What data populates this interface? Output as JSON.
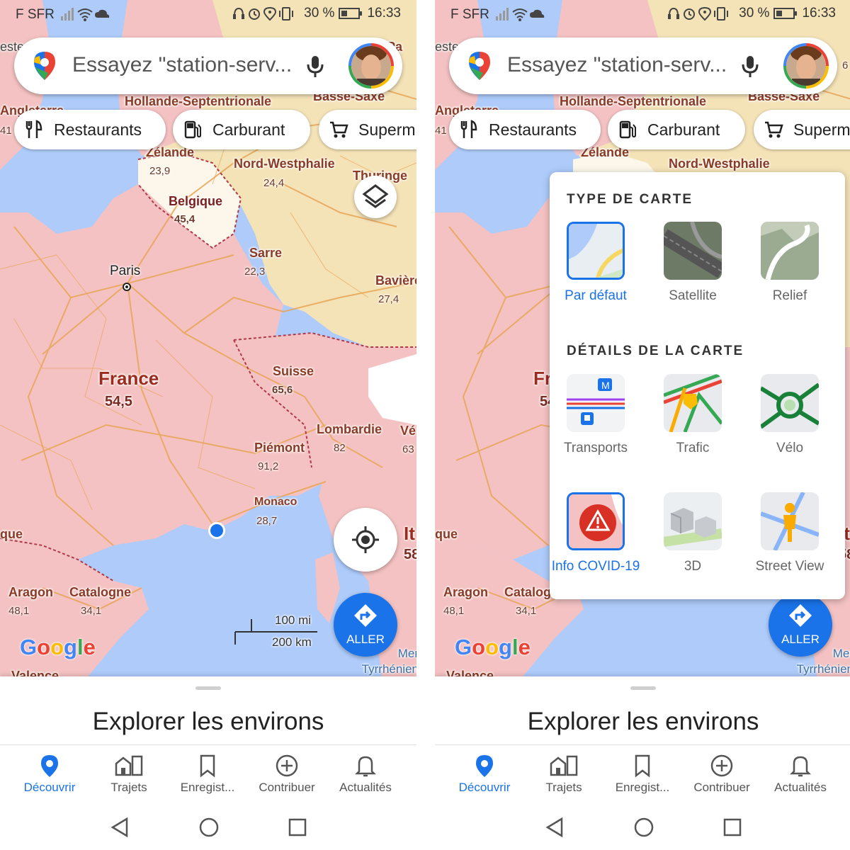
{
  "status_bar": {
    "carrier": "F SFR",
    "battery_percent": "30 %",
    "time": "16:33"
  },
  "search": {
    "placeholder": "Essayez \"station-serv..."
  },
  "chips": [
    {
      "label": "Restaurants",
      "icon": "restaurant-icon"
    },
    {
      "label": "Carburant",
      "icon": "fuel-icon"
    },
    {
      "label": "Superm",
      "icon": "cart-icon"
    }
  ],
  "map": {
    "labels": {
      "hollande": "Hollande-Septentrionale",
      "basse_saxe": "Basse-Saxe",
      "angleterre": "Angleterre",
      "zelande": "Zélande",
      "zelande_num": "23,9",
      "nord_westphalie": "Nord-Westphalie",
      "nrw_num": "24,4",
      "thuringe": "Thuringe",
      "belgique": "Belgique",
      "belgique_num": "45,4",
      "sarre": "Sarre",
      "sarre_num": "22,3",
      "paris": "Paris",
      "baviere": "Bavière",
      "baviere_num": "27,4",
      "france": "France",
      "france_num": "54,5",
      "suisse": "Suisse",
      "suisse_num": "65,6",
      "lombardie": "Lombardie",
      "lombardie_num": "82",
      "piemont": "Piémont",
      "piemont_num": "91,2",
      "venetie": "Vé",
      "venetie_num": "63",
      "monaco": "Monaco",
      "monaco_num": "28,7",
      "italie": "It",
      "italie_num": "58",
      "que": "que",
      "aragon": "Aragon",
      "aragon_num": "48,1",
      "catalogne": "Catalogne",
      "catalogne_num": "34,1",
      "valence": "Valence",
      "sea": "Mer Tyrrhénien",
      "num_41": "41",
      "pays_bas_top": "-Pa",
      "num_6": "6",
      "ouest": "este"
    },
    "google_logo": "Google",
    "scale_mi": "100 mi",
    "scale_km": "200 km",
    "go_label": "ALLER"
  },
  "sheet": {
    "title": "Explorer les environs"
  },
  "bottom_nav": [
    {
      "label": "Découvrir",
      "icon": "pin-icon",
      "active": true
    },
    {
      "label": "Trajets",
      "icon": "commute-icon",
      "active": false
    },
    {
      "label": "Enregist...",
      "icon": "bookmark-icon",
      "active": false
    },
    {
      "label": "Contribuer",
      "icon": "add-circle-icon",
      "active": false
    },
    {
      "label": "Actualités",
      "icon": "bell-icon",
      "active": false
    }
  ],
  "map_type_panel": {
    "type_heading": "TYPE DE CARTE",
    "types": [
      {
        "label": "Par défaut",
        "selected": true
      },
      {
        "label": "Satellite",
        "selected": false
      },
      {
        "label": "Relief",
        "selected": false
      }
    ],
    "details_heading": "DÉTAILS DE LA CARTE",
    "details": [
      {
        "label": "Transports",
        "selected": false
      },
      {
        "label": "Trafic",
        "selected": false
      },
      {
        "label": "Vélo",
        "selected": false
      },
      {
        "label": "Info COVID-19",
        "selected": true
      },
      {
        "label": "3D",
        "selected": false
      },
      {
        "label": "Street View",
        "selected": false
      }
    ]
  },
  "colors": {
    "accent": "#1a73e8",
    "covid_red": "#f4c2c2",
    "land": "#f5e8c8",
    "sea": "#aecbfa",
    "roads": "#e8a557"
  }
}
